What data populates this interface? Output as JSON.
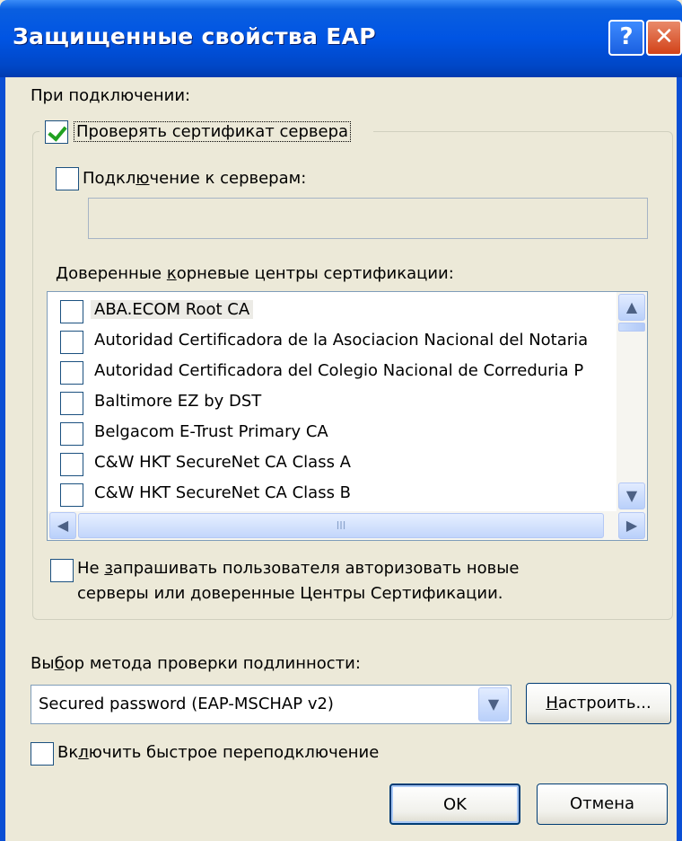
{
  "window": {
    "title": "Защищенные свойства EAP",
    "help_label": "?",
    "close_label": "✕"
  },
  "connect_label": "При подключении:",
  "verify_cert": {
    "label": "Проверять сертификат сервера",
    "checked": true
  },
  "connect_servers": {
    "label_pre": "Подкл",
    "label_u": "ю",
    "label_post": "чение к серверам:",
    "checked": false,
    "value": ""
  },
  "trusted_ca": {
    "label_pre": "Доверенные ",
    "label_u": "к",
    "label_post": "орневые центры сертификации:",
    "items": [
      {
        "label": "ABA.ECOM Root CA",
        "checked": false
      },
      {
        "label": "Autoridad Certificadora de la Asociacion Nacional del Notaria",
        "checked": false
      },
      {
        "label": "Autoridad Certificadora del Colegio Nacional de Correduria P",
        "checked": false
      },
      {
        "label": "Baltimore EZ by DST",
        "checked": false
      },
      {
        "label": "Belgacom E-Trust Primary CA",
        "checked": false
      },
      {
        "label": "C&W HKT SecureNet CA Class A",
        "checked": false
      },
      {
        "label": "C&W HKT SecureNet CA Class B",
        "checked": false
      }
    ],
    "scroll_up": "▲",
    "scroll_down": "▼",
    "scroll_left": "◀",
    "scroll_right": "▶",
    "grip": "III"
  },
  "no_prompt": {
    "label_pre": "Не ",
    "label_u": "з",
    "label_post": "апрашивать пользователя авторизовать новые",
    "label_line2": "серверы или доверенные Центры Сертификации.",
    "checked": false
  },
  "auth_method": {
    "label_pre": "Вы",
    "label_u": "б",
    "label_post": "ор метода проверки подлинности:",
    "selected": "Secured password (EAP-MSCHAP v2)",
    "arrow": "▼"
  },
  "configure_button": {
    "u": "Н",
    "rest": "астроить..."
  },
  "fast_reconnect": {
    "label_pre": "Вк",
    "label_u": "л",
    "label_post": "ючить быстрое переподключение",
    "checked": false
  },
  "ok_label": "OK",
  "cancel_label": "Отмена"
}
